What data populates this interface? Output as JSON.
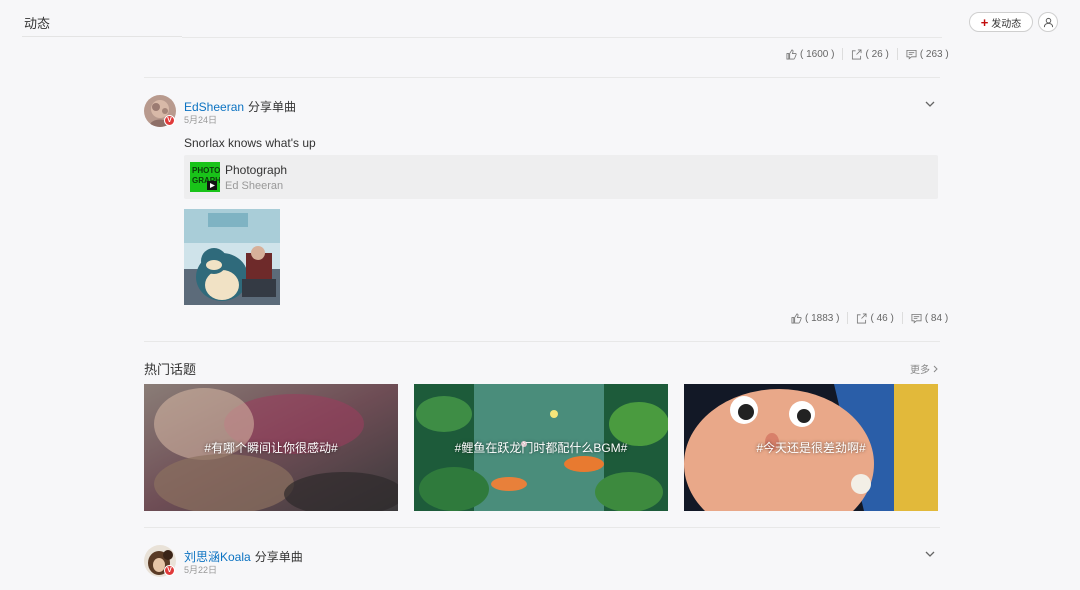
{
  "header": {
    "title": "动态",
    "post_button_label": "发动态",
    "user_icon": "user-icon"
  },
  "feed": {
    "prev_post_actions": {
      "likes": "( 1600 )",
      "shares": "( 26 )",
      "comments": "( 263 )"
    },
    "post": {
      "username": "EdSheeran",
      "action": "分享单曲",
      "date": "5月24日",
      "text": "Snorlax knows what's up",
      "song": {
        "title": "Photograph",
        "artist": "Ed Sheeran",
        "cover_text": "PHOTO GRAPH"
      },
      "image_caption": "SNORLAX",
      "actions": {
        "likes": "( 1883 )",
        "shares": "( 46 )",
        "comments": "( 84 )"
      }
    },
    "hot_topics": {
      "title": "热门话题",
      "more_label": "更多",
      "items": [
        {
          "label": "#有哪个瞬间让你很感动#"
        },
        {
          "label": "#鲤鱼在跃龙门时都配什么BGM#"
        },
        {
          "label": "#今天还是很差劲啊#"
        }
      ]
    },
    "next_post": {
      "username": "刘思涵Koala",
      "action": "分享单曲",
      "date": "5月22日"
    }
  },
  "colors": {
    "accent_red": "#c20c0c",
    "link_blue": "#0c73c2",
    "background": "#f7f7f9"
  }
}
